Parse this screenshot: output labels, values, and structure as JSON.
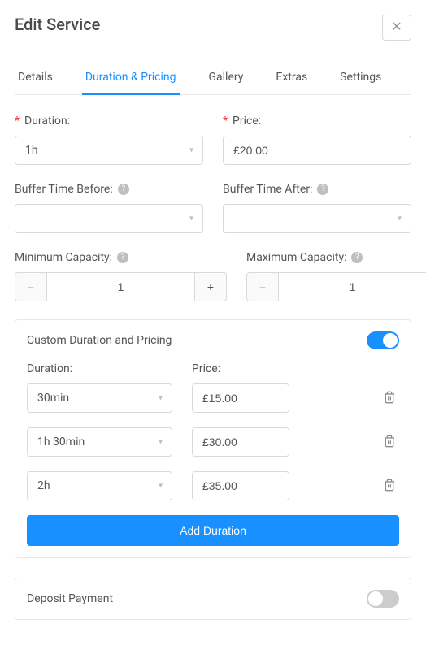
{
  "modal": {
    "title": "Edit Service"
  },
  "tabs": {
    "items": [
      {
        "label": "Details",
        "active": false
      },
      {
        "label": "Duration & Pricing",
        "active": true
      },
      {
        "label": "Gallery",
        "active": false
      },
      {
        "label": "Extras",
        "active": false
      },
      {
        "label": "Settings",
        "active": false
      }
    ]
  },
  "form": {
    "duration": {
      "label": "Duration:",
      "value": "1h",
      "required": true
    },
    "price": {
      "label": "Price:",
      "value": "£20.00",
      "required": true
    },
    "bufferBefore": {
      "label": "Buffer Time Before:",
      "value": ""
    },
    "bufferAfter": {
      "label": "Buffer Time After:",
      "value": ""
    },
    "minCapacity": {
      "label": "Minimum Capacity:",
      "value": "1"
    },
    "maxCapacity": {
      "label": "Maximum Capacity:",
      "value": "1"
    }
  },
  "customPricing": {
    "title": "Custom Duration and Pricing",
    "enabled": true,
    "durationLabel": "Duration:",
    "priceLabel": "Price:",
    "rows": [
      {
        "duration": "30min",
        "price": "£15.00"
      },
      {
        "duration": "1h  30min",
        "price": "£30.00"
      },
      {
        "duration": "2h",
        "price": "£35.00"
      }
    ],
    "addButton": "Add Duration"
  },
  "deposit": {
    "title": "Deposit Payment",
    "enabled": false
  }
}
